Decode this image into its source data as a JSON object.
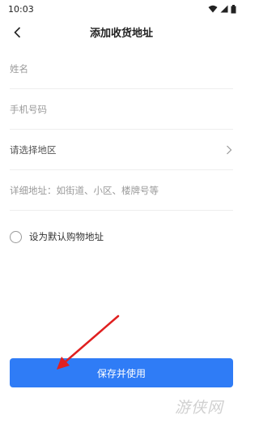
{
  "status_bar": {
    "time": "10:03"
  },
  "header": {
    "title": "添加收货地址"
  },
  "form": {
    "name_placeholder": "姓名",
    "phone_placeholder": "手机号码",
    "region_label": "请选择地区",
    "detail_placeholder": "详细地址：如街道、小区、楼牌号等"
  },
  "default_address": {
    "label": "设为默认购物地址"
  },
  "save_button": {
    "label": "保存并使用"
  },
  "watermark": {
    "text": "游侠网"
  },
  "colors": {
    "accent": "#2f7cf6",
    "annotation_arrow": "#e02020"
  }
}
